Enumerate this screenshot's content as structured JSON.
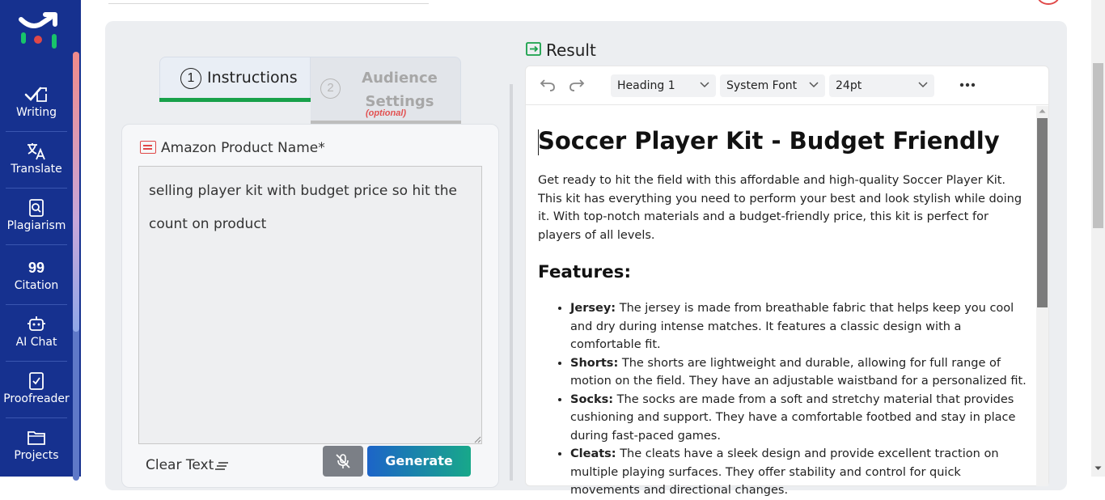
{
  "sidebar": {
    "items": [
      {
        "label": "Writing",
        "icon": "writing-check-icon"
      },
      {
        "label": "Translate",
        "icon": "translate-icon"
      },
      {
        "label": "Plagiarism",
        "icon": "plagiarism-search-icon"
      },
      {
        "label": "Citation",
        "icon": "quote-icon",
        "glyph": "99"
      },
      {
        "label": "AI Chat",
        "icon": "robot-icon"
      },
      {
        "label": "Proofreader",
        "icon": "proofreader-icon"
      },
      {
        "label": "Projects",
        "icon": "folder-icon"
      }
    ]
  },
  "tabs": {
    "instructions": {
      "number": "1",
      "label": "Instructions"
    },
    "audience": {
      "number": "2",
      "label": "Audience Settings",
      "note": "(optional)"
    }
  },
  "form": {
    "field_label": "Amazon Product Name*",
    "field_value": "selling player kit with budget price so hit the count on product",
    "clear_label": "Clear Text",
    "generate_label": "Generate"
  },
  "result": {
    "title": "Result",
    "toolbar": {
      "block_format": "Heading 1",
      "font_family": "System Font",
      "font_size": "24pt"
    },
    "document": {
      "heading": "Soccer Player Kit - Budget Friendly",
      "intro": "Get ready to hit the field with this affordable and high-quality Soccer Player Kit. This kit has everything you need to perform your best and look stylish while doing it. With top-notch materials and a budget-friendly price, this kit is perfect for players of all levels.",
      "features_heading": "Features:",
      "features": [
        {
          "term": "Jersey:",
          "text": " The jersey is made from breathable fabric that helps keep you cool and dry during intense matches. It features a classic design with a comfortable fit."
        },
        {
          "term": "Shorts:",
          "text": " The shorts are lightweight and durable, allowing for full range of motion on the field. They have an adjustable waistband for a personalized fit."
        },
        {
          "term": "Socks:",
          "text": " The socks are made from a soft and stretchy material that provides cushioning and support. They have a comfortable footbed and stay in place during fast-paced games."
        },
        {
          "term": "Cleats:",
          "text": " The cleats have a sleek design and provide excellent traction on multiple playing surfaces. They offer stability and control for quick movements and directional changes."
        }
      ]
    }
  },
  "colors": {
    "sidebar_bg": "#16318f",
    "accent_green": "#18a14a",
    "accent_red": "#e04848",
    "generate_gradient_start": "#1c64c8",
    "generate_gradient_end": "#18a88a"
  }
}
